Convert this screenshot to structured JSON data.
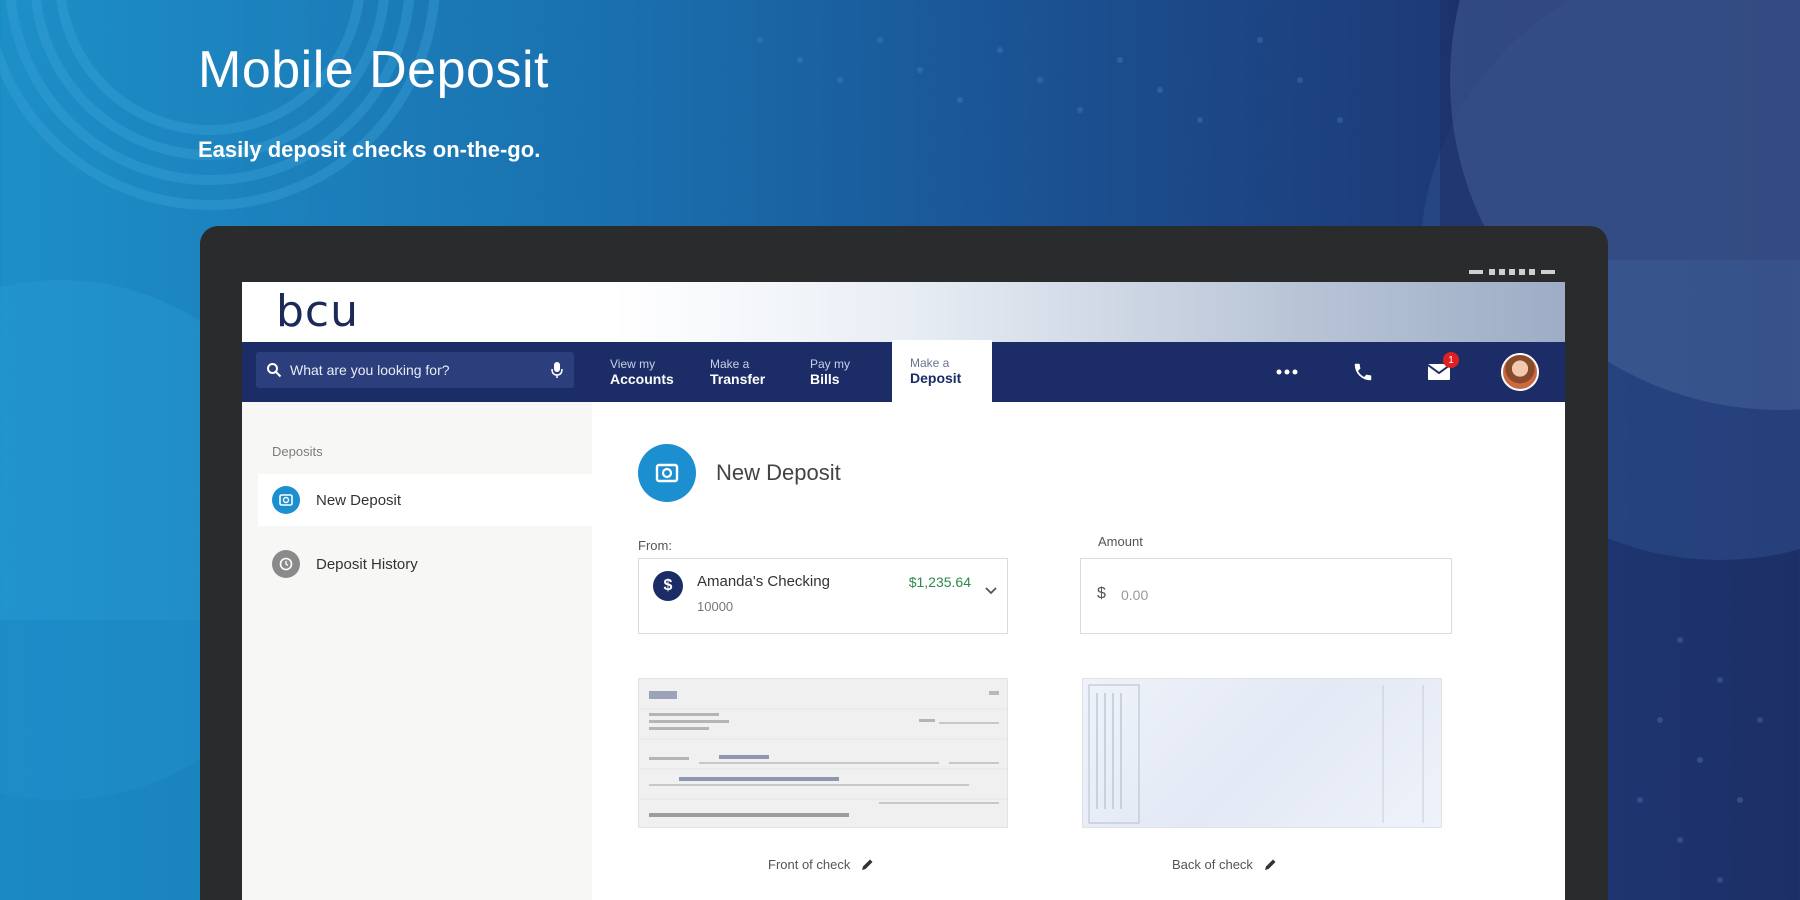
{
  "hero": {
    "title": "Mobile Deposit",
    "subtitle": "Easily deposit checks on-the-go."
  },
  "colors": {
    "navy": "#1c2c66",
    "accent_blue": "#1b8fcf",
    "balance_green": "#2c8a4a"
  },
  "app": {
    "logo_text": "bcu",
    "search": {
      "placeholder": "What are you looking for?",
      "icon": "search-icon",
      "mic_icon": "microphone-icon"
    },
    "nav_tabs": [
      {
        "line1": "View my",
        "line2": "Accounts",
        "active": false
      },
      {
        "line1": "Make a",
        "line2": "Transfer",
        "active": false
      },
      {
        "line1": "Pay my",
        "line2": "Bills",
        "active": false
      },
      {
        "line1": "Make a",
        "line2": "Deposit",
        "active": true
      }
    ],
    "nav_icons": [
      "more-icon",
      "phone-icon",
      "mail-icon",
      "avatar"
    ],
    "mail_badge_count": "1"
  },
  "sidebar": {
    "heading": "Deposits",
    "items": [
      {
        "label": "New Deposit",
        "icon": "camera-icon",
        "active": true
      },
      {
        "label": "Deposit History",
        "icon": "history-icon",
        "active": false
      }
    ]
  },
  "main": {
    "title": "New Deposit",
    "from_label": "From:",
    "amount_label": "Amount",
    "account": {
      "name": "Amanda's Checking",
      "number": "10000",
      "balance": "$1,235.64",
      "icon_letter": "$"
    },
    "amount": {
      "currency": "$",
      "placeholder": "0.00"
    },
    "front_caption": "Front of check",
    "back_caption": "Back of check"
  }
}
